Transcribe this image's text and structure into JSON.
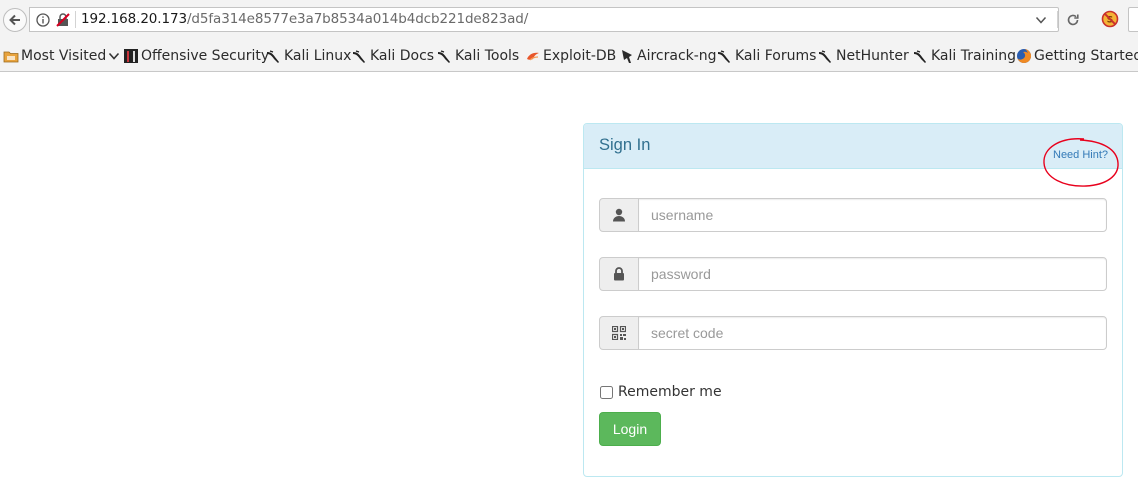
{
  "browser": {
    "url_host": "192.168.20.173",
    "url_path": "/d5fa314e8577e3a7b8534a014b4dcb221de823ad/",
    "bookmarks": [
      {
        "label": "Most Visited",
        "icon": "folder-icon"
      },
      {
        "label": "Offensive Security",
        "icon": "offsec-icon"
      },
      {
        "label": "Kali Linux",
        "icon": "kali-dragon-icon"
      },
      {
        "label": "Kali Docs",
        "icon": "kali-dragon-icon"
      },
      {
        "label": "Kali Tools",
        "icon": "kali-dragon-icon"
      },
      {
        "label": "Exploit-DB",
        "icon": "exploitdb-icon"
      },
      {
        "label": "Aircrack-ng",
        "icon": "aircrack-icon"
      },
      {
        "label": "Kali Forums",
        "icon": "kali-dragon-icon"
      },
      {
        "label": "NetHunter",
        "icon": "kali-dragon-icon"
      },
      {
        "label": "Kali Training",
        "icon": "kali-dragon-icon"
      },
      {
        "label": "Getting Started",
        "icon": "firefox-icon"
      }
    ]
  },
  "signin": {
    "title": "Sign In",
    "hint_link": "Need Hint?",
    "username_placeholder": "username",
    "password_placeholder": "password",
    "secret_placeholder": "secret code",
    "remember_label": "Remember me",
    "login_label": "Login"
  },
  "colors": {
    "panel_heading_bg": "#d9edf7",
    "panel_title": "#31708f",
    "link": "#337ab7",
    "login_button": "#5cb85c",
    "hint_annotation": "#e8001c"
  }
}
